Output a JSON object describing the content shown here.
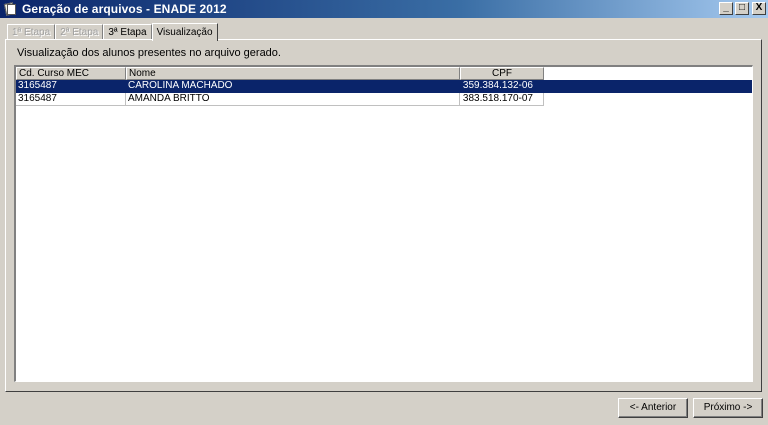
{
  "window": {
    "title": "Geração de arquivos - ENADE 2012",
    "controls": {
      "minimize": "_",
      "maximize": "□",
      "close": "X"
    }
  },
  "tabs": [
    {
      "label": "1ª Etapa",
      "state": "disabled"
    },
    {
      "label": "2ª Etapa",
      "state": "disabled"
    },
    {
      "label": "3ª Etapa",
      "state": "enabled"
    },
    {
      "label": "Visualização",
      "state": "active"
    }
  ],
  "panel": {
    "description": "Visualização dos alunos presentes no arquivo gerado."
  },
  "grid": {
    "columns": [
      "Cd. Curso MEC",
      "Nome",
      "CPF"
    ],
    "rows": [
      {
        "code": "3165487",
        "name": "CAROLINA MACHADO",
        "cpf": "359.384.132-06",
        "selected": true
      },
      {
        "code": "3165487",
        "name": "AMANDA BRITTO",
        "cpf": "383.518.170-07",
        "selected": false
      }
    ]
  },
  "buttons": {
    "previous": "<- Anterior",
    "next": "Próximo ->"
  },
  "colors": {
    "title_start": "#0a246a",
    "title_end": "#a6caf0",
    "face": "#d4d0c8",
    "selection": "#0a246a"
  },
  "icons": {
    "app": "document-pages-icon"
  }
}
